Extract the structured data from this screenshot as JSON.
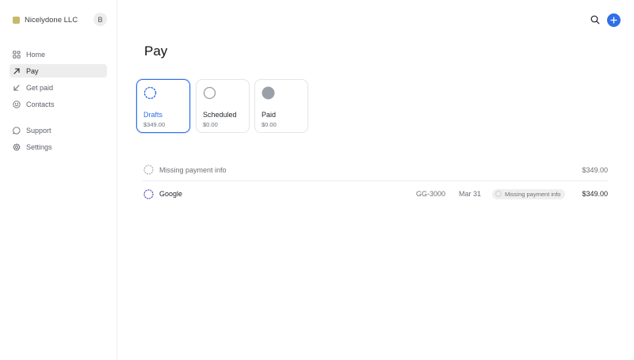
{
  "org": {
    "name": "Nicelydone LLC",
    "swatch_color": "#c8b96a",
    "avatar_initial": "B"
  },
  "nav": {
    "primary": [
      {
        "label": "Home",
        "icon": "home-icon",
        "active": false
      },
      {
        "label": "Pay",
        "icon": "arrow-up-right-icon",
        "active": true
      },
      {
        "label": "Get paid",
        "icon": "arrow-down-left-icon",
        "active": false
      },
      {
        "label": "Contacts",
        "icon": "smile-icon",
        "active": false
      }
    ],
    "secondary": [
      {
        "label": "Support",
        "icon": "chat-bubble-icon",
        "active": false
      },
      {
        "label": "Settings",
        "icon": "gear-icon",
        "active": false
      }
    ]
  },
  "header": {
    "search_icon": "search-icon",
    "add_icon": "plus-icon",
    "accent": "#2f6fe8"
  },
  "page": {
    "title": "Pay"
  },
  "cards": [
    {
      "label": "Drafts",
      "amount": "$349.00",
      "icon": "dashed-circle-icon",
      "active": true
    },
    {
      "label": "Scheduled",
      "amount": "$0.00",
      "icon": "hollow-circle-icon",
      "active": false
    },
    {
      "label": "Paid",
      "amount": "$0.00",
      "icon": "filled-circle-icon",
      "active": false
    }
  ],
  "groups": [
    {
      "title": "Missing payment info",
      "amount": "$349.00",
      "items": [
        {
          "name": "Google",
          "ref": "GG-3000",
          "date": "Mar 31",
          "status": "Missing payment info",
          "amount": "$349.00"
        }
      ]
    }
  ]
}
